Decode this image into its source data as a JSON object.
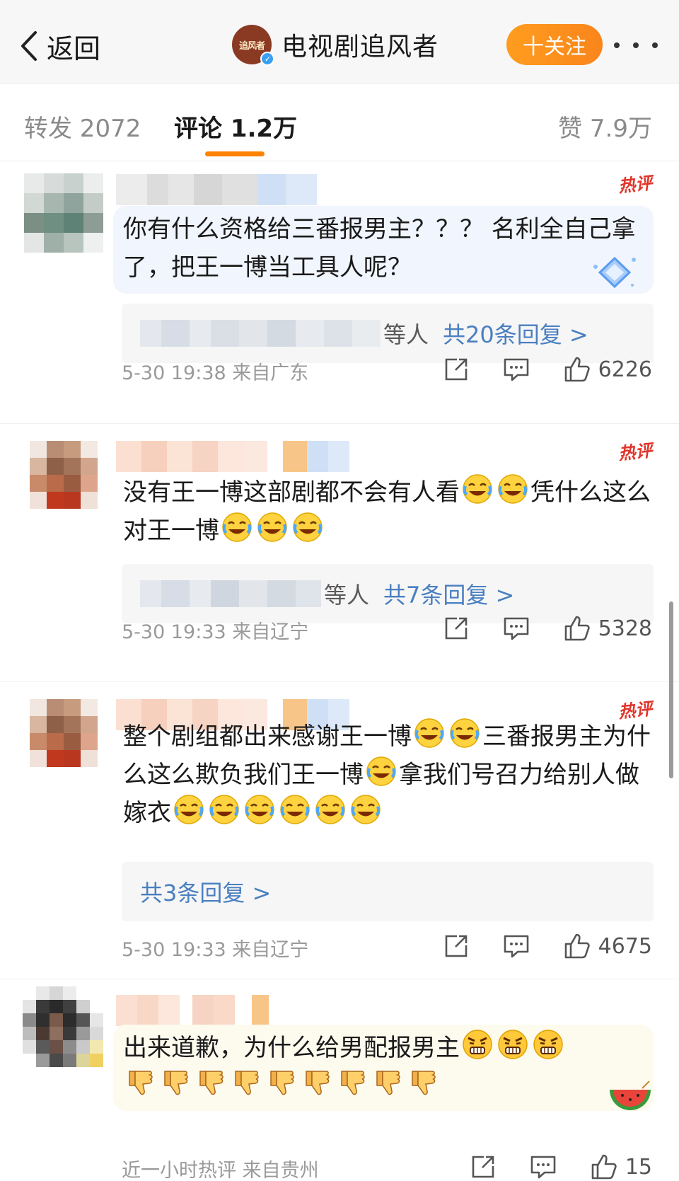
{
  "nav": {
    "back_label": "返回",
    "account_name": "电视剧追风者",
    "account_logo_text": "追风者",
    "follow_label": "十关注"
  },
  "tabs": {
    "repost": "转发 2072",
    "comment": "评论 1.2万",
    "like": "赞 7.9万"
  },
  "comments": [
    {
      "hot_tag": "热评",
      "text": "你有什么资格给三番报男主？？？ 名利全自己拿了，把王一博当工具人呢？",
      "replies_who": "等人",
      "replies_count": "共20条回复 >",
      "time_location": "5-30 19:38 来自广东",
      "likes": "6226"
    },
    {
      "hot_tag": "热评",
      "text_part1": "没有王一博这部剧都不会有人看",
      "text_part2": "凭什么这么对王一博",
      "replies_who": "等人",
      "replies_count": "共7条回复 >",
      "time_location": "5-30 19:33 来自辽宁",
      "likes": "5328"
    },
    {
      "hot_tag": "热评",
      "text_part1": "整个剧组都出来感谢王一博",
      "text_part2": "三番报男主为什么这么欺负我们王一博",
      "text_part3": "拿我们号召力给别人做嫁衣",
      "replies_count": "共3条回复 >",
      "time_location": "5-30 19:33 来自辽宁",
      "likes": "4675"
    },
    {
      "text": "出来道歉，为什么给男配报男主",
      "time_location": "近一小时热评 来自贵州",
      "likes": "15"
    }
  ],
  "icons": {
    "back": "chevron-left-icon",
    "verified": "verified-badge-icon",
    "more": "more-dots-icon",
    "share": "share-icon",
    "comment": "comment-icon",
    "like": "thumbs-up-icon",
    "emoji_laugh_cry": "laugh-cry-emoji",
    "emoji_angry": "angry-emoji",
    "emoji_thumbs_down": "thumbs-down-emoji",
    "watermelon": "watermelon-icon",
    "diamond": "diamond-sticker-icon"
  },
  "colors": {
    "accent": "#ff8200",
    "reply_link": "#4a7fc1",
    "hot_tag": "#e0352b",
    "bubble_blue": "#f1f5fd",
    "bubble_yellow": "#fdfaee"
  }
}
